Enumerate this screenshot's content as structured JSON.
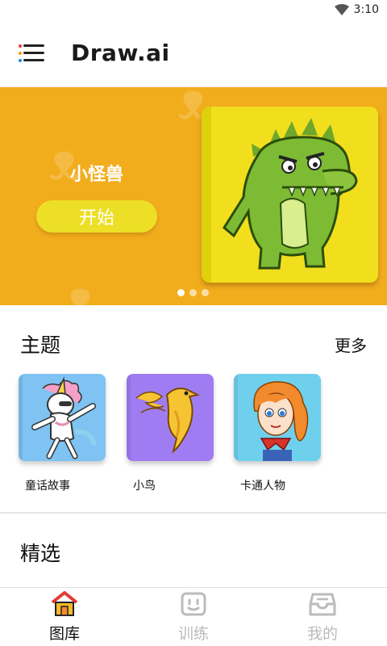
{
  "status_bar": {
    "time": "3:10",
    "wifi_icon": "wifi-icon"
  },
  "app_bar": {
    "title": "Draw.ai",
    "menu_icon": "menu-icon"
  },
  "banner": {
    "title": "小怪兽",
    "start_label": "开始",
    "background_color": "#f2ad1d",
    "page_count": 3,
    "active_page": 1
  },
  "themes_section": {
    "title": "主题",
    "more_label": "更多",
    "items": [
      {
        "label": "童话故事",
        "icon": "unicorn-image",
        "color": "#7ec3f2"
      },
      {
        "label": "小鸟",
        "icon": "bird-image",
        "color": "#a07cf3"
      },
      {
        "label": "卡通人物",
        "icon": "cartoon-girl-image",
        "color": "#6fd0ee"
      }
    ]
  },
  "featured_section": {
    "title": "精选"
  },
  "bottom_nav": {
    "items": [
      {
        "label": "图库",
        "icon": "house-icon",
        "active": true
      },
      {
        "label": "训练",
        "icon": "robot-face-icon",
        "active": false
      },
      {
        "label": "我的",
        "icon": "inbox-icon",
        "active": false
      }
    ]
  }
}
